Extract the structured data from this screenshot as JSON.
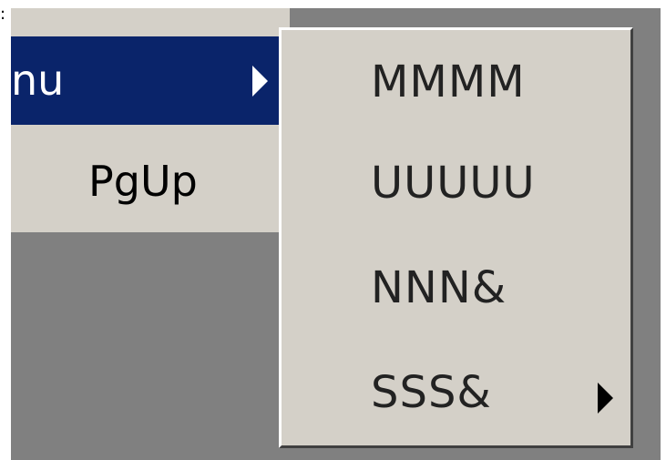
{
  "parent_menu": {
    "items": [
      {
        "label": "nu",
        "selected": true,
        "has_submenu": true
      },
      {
        "label": "PgUp",
        "selected": false,
        "has_submenu": false
      }
    ]
  },
  "submenu": {
    "items": [
      {
        "label": "MMMM",
        "has_submenu": false
      },
      {
        "label": "UUUUU",
        "has_submenu": false
      },
      {
        "label": "NNN&",
        "has_submenu": false
      },
      {
        "label": "SSS&",
        "has_submenu": true
      }
    ]
  },
  "colors": {
    "menu_face": "#d4d0c8",
    "selection": "#0a246a",
    "desktop": "#808080"
  }
}
